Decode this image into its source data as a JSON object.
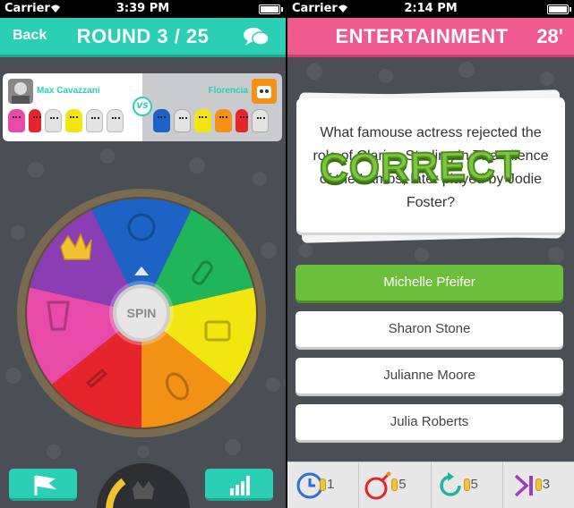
{
  "left_screen": {
    "status": {
      "carrier": "Carrier",
      "time": "3:39 PM"
    },
    "header": {
      "back_label": "Back",
      "title": "ROUND 3 / 25"
    },
    "players": {
      "player1": {
        "name": "Max Cavazzani"
      },
      "player2": {
        "name": "Florencia"
      },
      "vs_label": "VS"
    },
    "wheel": {
      "spin_label": "SPIN",
      "segments": [
        {
          "category": "geography",
          "color": "#1d63c6"
        },
        {
          "category": "science",
          "color": "#20b55a"
        },
        {
          "category": "entertainment",
          "color": "#f1e60f"
        },
        {
          "category": "sports",
          "color": "#f39115"
        },
        {
          "category": "art",
          "color": "#e6242b"
        },
        {
          "category": "entertainment-pop",
          "color": "#e84aa9"
        },
        {
          "category": "crown",
          "color": "#8b3db4"
        }
      ]
    },
    "bottom": {
      "left_icon": "flag-icon",
      "center_icon": "crown-icon",
      "right_icon": "stats-icon"
    }
  },
  "right_screen": {
    "status": {
      "carrier": "Carrier",
      "time": "2:14 PM"
    },
    "header": {
      "title": "ENTERTAINMENT",
      "timer": "28'"
    },
    "question": "What famouse actress rejected the role of Clarice Starling in The Silence of the Lambs, later played by Jodie Foster?",
    "result_label": "CORRECT",
    "answers": [
      {
        "label": "Michelle Pfeifer",
        "state": "correct"
      },
      {
        "label": "Sharon Stone",
        "state": "default"
      },
      {
        "label": "Julianne Moore",
        "state": "default"
      },
      {
        "label": "Julia Roberts",
        "state": "default"
      }
    ],
    "powerups": [
      {
        "icon": "clock-icon",
        "count": "1"
      },
      {
        "icon": "bomb-icon",
        "count": "5"
      },
      {
        "icon": "retry-icon",
        "count": "5"
      },
      {
        "icon": "skip-icon",
        "count": "3"
      }
    ]
  }
}
